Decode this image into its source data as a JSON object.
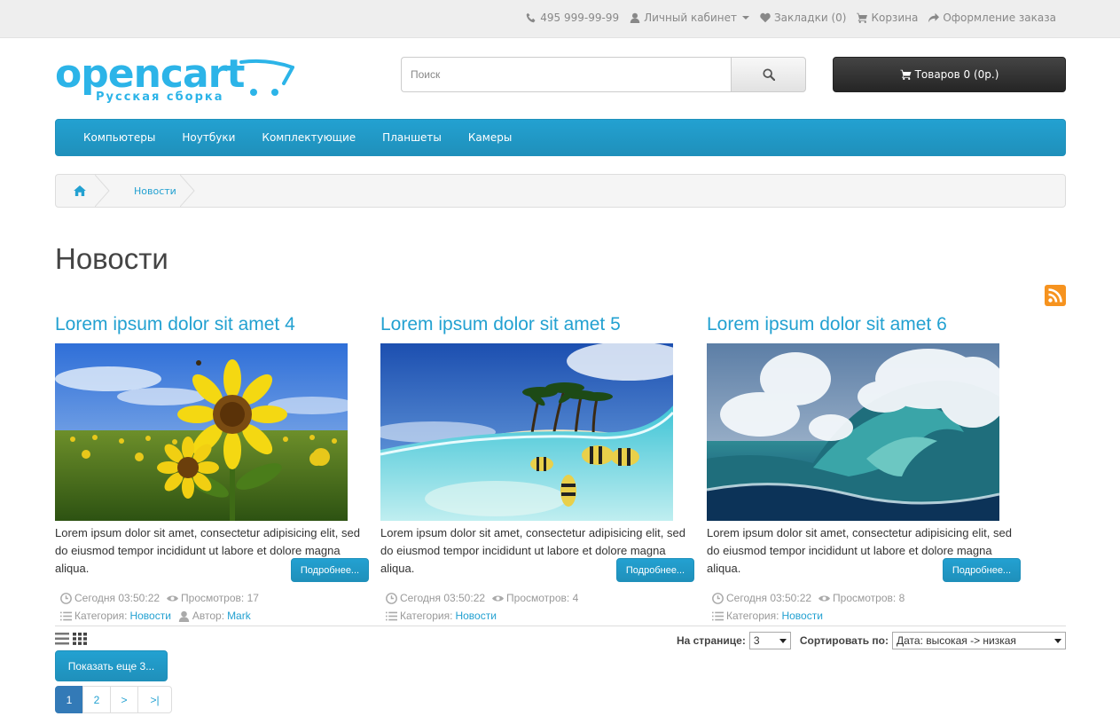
{
  "topbar": {
    "phone": "495 999-99-99",
    "account": "Личный кабинет",
    "wishlist": "Закладки (0)",
    "cart": "Корзина",
    "checkout": "Оформление заказа"
  },
  "logo": {
    "word": "opencart",
    "subtitle": "Русская сборка"
  },
  "search": {
    "placeholder": "Поиск"
  },
  "cart_button": {
    "label": "Товаров 0 (0р.)"
  },
  "menu": [
    "Компьютеры",
    "Ноутбуки",
    "Комплектующие",
    "Планшеты",
    "Камеры"
  ],
  "breadcrumb": {
    "current": "Новости"
  },
  "page_title": "Новости",
  "articles": [
    {
      "title": "Lorem ipsum dolor sit amet 4",
      "desc": "Lorem ipsum dolor sit amet, consectetur adipisicing elit, sed do eiusmod tempor incididunt ut labore et dolore magna aliqua.",
      "more": "Подробнее...",
      "date": "Сегодня 03:50:22",
      "views": "Просмотров: 17",
      "category_label": "Категория:",
      "category": "Новости",
      "author_label": "Автор:",
      "author": "Mark"
    },
    {
      "title": "Lorem ipsum dolor sit amet 5",
      "desc": "Lorem ipsum dolor sit amet, consectetur adipisicing elit, sed do eiusmod tempor incididunt ut labore et dolore magna aliqua.",
      "more": "Подробнее...",
      "date": "Сегодня 03:50:22",
      "views": "Просмотров: 4",
      "category_label": "Категория:",
      "category": "Новости"
    },
    {
      "title": "Lorem ipsum dolor sit amet 6",
      "desc": "Lorem ipsum dolor sit amet, consectetur adipisicing elit, sed do eiusmod tempor incididunt ut labore et dolore magna aliqua.",
      "more": "Подробнее...",
      "date": "Сегодня 03:50:22",
      "views": "Просмотров: 8",
      "category_label": "Категория:",
      "category": "Новости"
    }
  ],
  "toolbar": {
    "per_page_label": "На странице:",
    "per_page_value": "3",
    "sort_label": "Сортировать по:",
    "sort_value": "Дата: высокая -> низкая"
  },
  "show_more": "Показать еще 3...",
  "pagination": [
    "1",
    "2",
    ">",
    ">|"
  ],
  "colors": {
    "accent": "#23a1d1",
    "rss": "#f6931f",
    "active_page": "#337ab7"
  }
}
